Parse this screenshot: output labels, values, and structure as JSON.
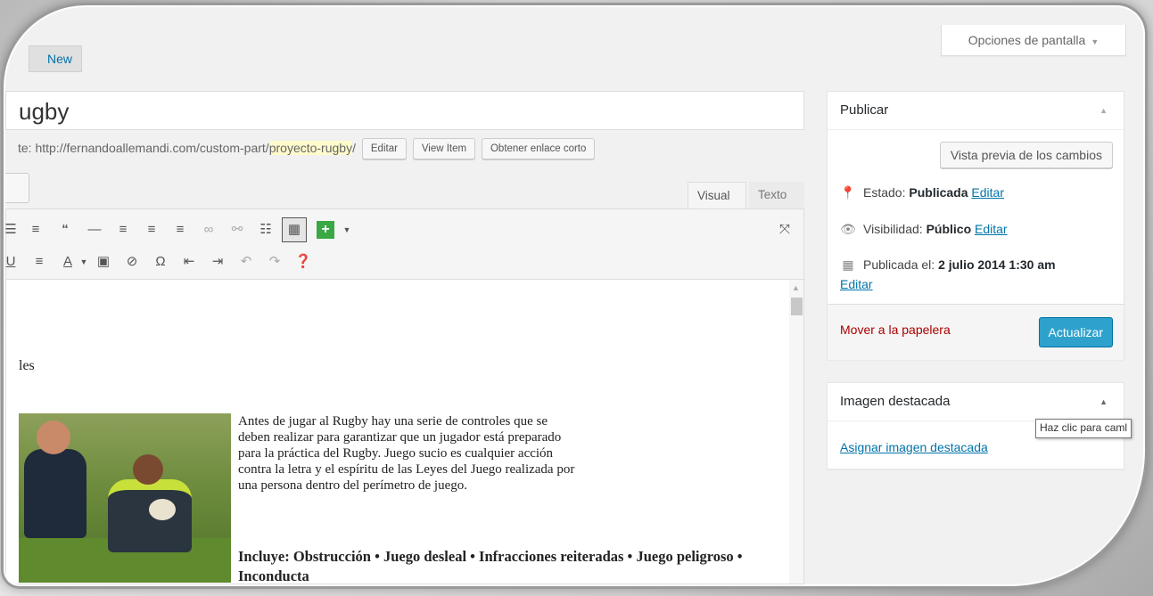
{
  "header": {
    "add_new": "New",
    "screen_options": "Opciones de pantalla"
  },
  "editor": {
    "title": "ugby",
    "permalink_prefix": "te: http://fernandoallemandi.com/custom-part/",
    "permalink_slug": "proyecto-rugby",
    "permalink_suffix": "/",
    "edit_btn": "Editar",
    "view_btn": "View Item",
    "shortlink_btn": "Obtener enlace corto",
    "tab_visual": "Visual",
    "tab_text": "Texto",
    "content": {
      "line_les": "les",
      "paragraph": "Antes de jugar al Rugby hay una serie de controles que se deben realizar para garantizar que un jugador está preparado para la práctica del Rugby. Juego sucio es cualquier acción contra la letra y el espíritu de las Leyes del Juego realizada por una persona dentro del perímetro de juego.",
      "includes": "Incluye:  Obstrucción • Juego desleal • Infracciones reiteradas • Juego peligroso • Inconducta"
    }
  },
  "publish_box": {
    "title": "Publicar",
    "preview": "Vista previa de los cambios",
    "status_label": "Estado:",
    "status_value": "Publicada",
    "visibility_label": "Visibilidad:",
    "visibility_value": "Público",
    "published_label": "Publicada el:",
    "published_value": "2 julio 2014 1:30 am",
    "edit_link": "Editar",
    "trash": "Mover a la papelera",
    "update": "Actualizar"
  },
  "featured_box": {
    "title": "Imagen destacada",
    "link": "Asignar imagen destacada",
    "tooltip": "Haz clic para caml"
  },
  "colors": {
    "primary": "#2ea2cc",
    "link": "#0073aa",
    "trash": "#a00000",
    "slug_highlight": "#fffbcc",
    "add_media": "#39a844"
  },
  "icons": [
    "list-icon",
    "numbered-list-icon",
    "blockquote-icon",
    "hr-icon",
    "align-left-icon",
    "align-center-icon",
    "align-right-icon",
    "link-icon",
    "unlink-icon",
    "read-more-icon",
    "kitchen-sink-icon",
    "add-icon",
    "chevron-down-icon",
    "fullscreen-icon",
    "underline-icon",
    "justify-icon",
    "text-color-icon",
    "paste-text-icon",
    "clear-format-icon",
    "omega-icon",
    "outdent-icon",
    "indent-icon",
    "undo-icon",
    "redo-icon",
    "help-icon",
    "pin-icon",
    "eye-icon",
    "calendar-icon"
  ]
}
